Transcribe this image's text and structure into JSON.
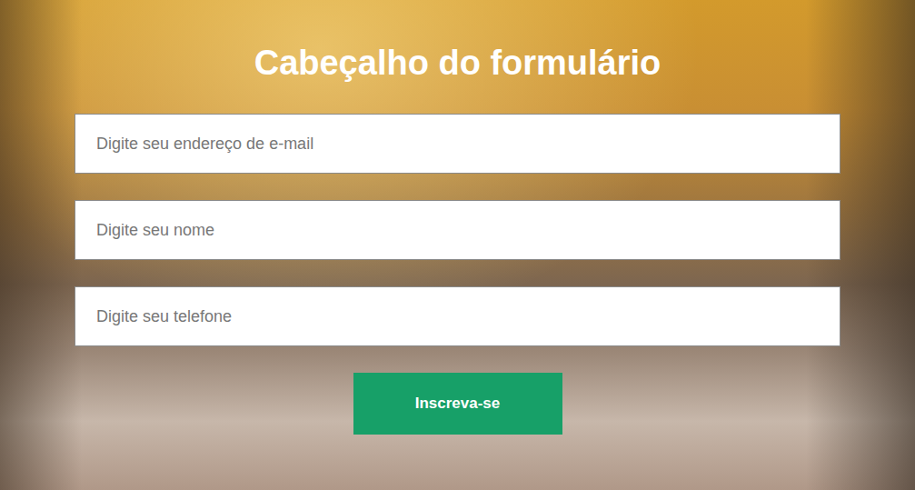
{
  "form": {
    "title": "Cabeçalho do formulário",
    "fields": [
      {
        "placeholder": "Digite seu endereço de e-mail"
      },
      {
        "placeholder": "Digite seu nome"
      },
      {
        "placeholder": "Digite seu telefone"
      }
    ],
    "button": "Inscreva-se"
  }
}
